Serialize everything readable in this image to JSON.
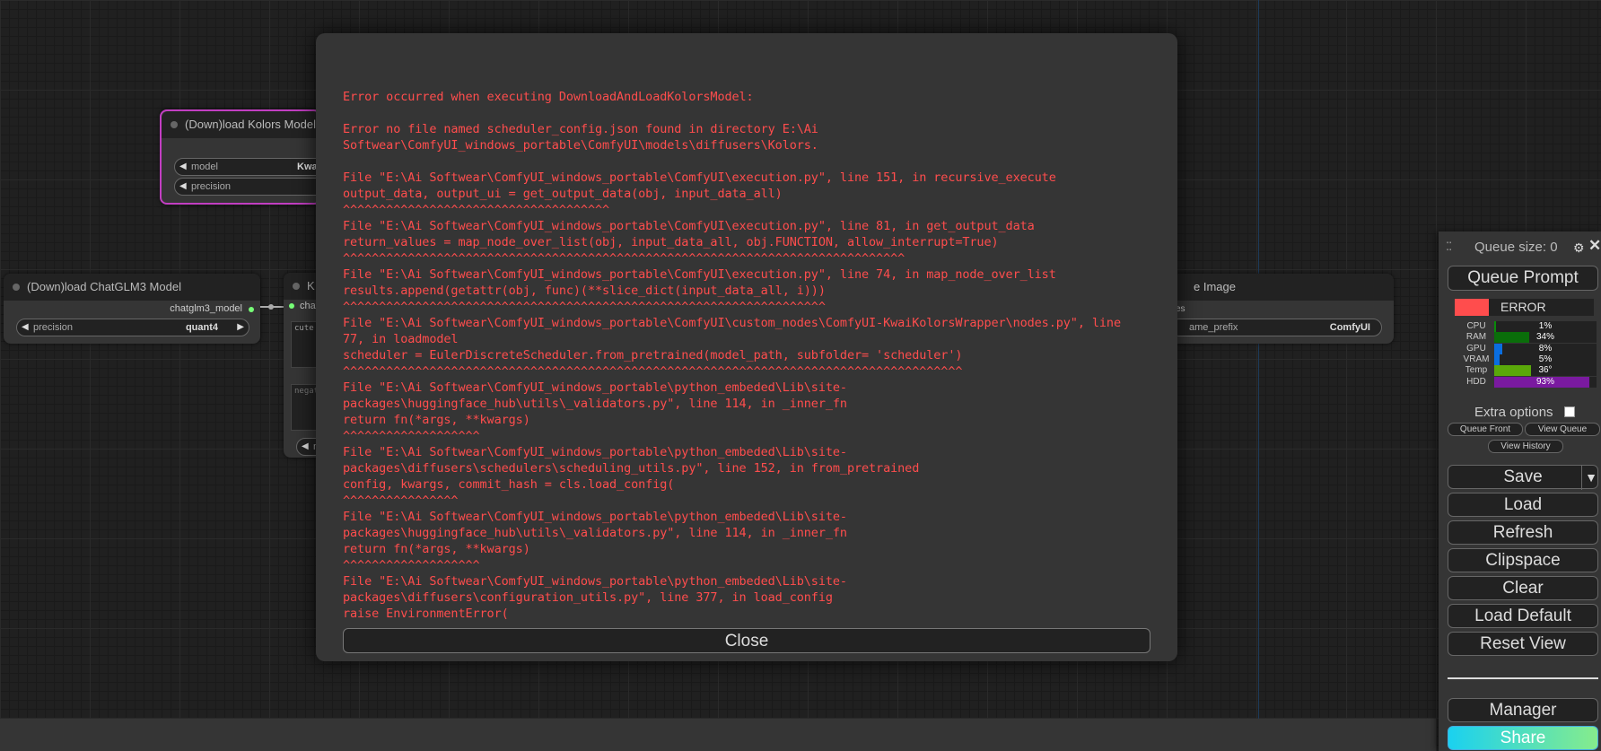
{
  "nodes": {
    "kolors": {
      "title": "(Down)load Kolors Model",
      "model_label": "model",
      "model_value": "Kwai",
      "precision_label": "precision"
    },
    "chatglm": {
      "title": "(Down)load ChatGLM3 Model",
      "output_label": "chatglm3_model",
      "precision_label": "precision",
      "precision_value": "quant4"
    },
    "encode": {
      "title": "K",
      "input_label": "chat",
      "positive_text": "cute",
      "negative_text": "negat",
      "widget_stub": "n"
    },
    "save_image": {
      "title": "e Image",
      "input_label": "es",
      "filename_label": "ame_prefix",
      "filename_value": "ComfyUI"
    }
  },
  "error_dialog": {
    "lines": [
      "",
      "Error occurred when executing DownloadAndLoadKolorsModel:",
      "",
      "Error no file named scheduler_config.json found in directory E:\\Ai",
      "Softwear\\ComfyUI_windows_portable\\ComfyUI\\models\\diffusers\\Kolors.",
      "",
      "File \"E:\\Ai Softwear\\ComfyUI_windows_portable\\ComfyUI\\execution.py\", line 151, in recursive_execute",
      "output_data, output_ui = get_output_data(obj, input_data_all)",
      "^^^^^^^^^^^^^^^^^^^^^^^^^^^^^^^^^^^^^",
      "File \"E:\\Ai Softwear\\ComfyUI_windows_portable\\ComfyUI\\execution.py\", line 81, in get_output_data",
      "return_values = map_node_over_list(obj, input_data_all, obj.FUNCTION, allow_interrupt=True)",
      "^^^^^^^^^^^^^^^^^^^^^^^^^^^^^^^^^^^^^^^^^^^^^^^^^^^^^^^^^^^^^^^^^^^^^^^^^^^^^^",
      "File \"E:\\Ai Softwear\\ComfyUI_windows_portable\\ComfyUI\\execution.py\", line 74, in map_node_over_list",
      "results.append(getattr(obj, func)(**slice_dict(input_data_all, i)))",
      "^^^^^^^^^^^^^^^^^^^^^^^^^^^^^^^^^^^^^^^^^^^^^^^^^^^^^^^^^^^^^^^^^^^",
      "File \"E:\\Ai Softwear\\ComfyUI_windows_portable\\ComfyUI\\custom_nodes\\ComfyUI-KwaiKolorsWrapper\\nodes.py\", line",
      "77, in loadmodel",
      "scheduler = EulerDiscreteScheduler.from_pretrained(model_path, subfolder= 'scheduler')",
      "^^^^^^^^^^^^^^^^^^^^^^^^^^^^^^^^^^^^^^^^^^^^^^^^^^^^^^^^^^^^^^^^^^^^^^^^^^^^^^^^^^^^^^",
      "File \"E:\\Ai Softwear\\ComfyUI_windows_portable\\python_embeded\\Lib\\site-",
      "packages\\huggingface_hub\\utils\\_validators.py\", line 114, in _inner_fn",
      "return fn(*args, **kwargs)",
      "^^^^^^^^^^^^^^^^^^^",
      "File \"E:\\Ai Softwear\\ComfyUI_windows_portable\\python_embeded\\Lib\\site-",
      "packages\\diffusers\\schedulers\\scheduling_utils.py\", line 152, in from_pretrained",
      "config, kwargs, commit_hash = cls.load_config(",
      "^^^^^^^^^^^^^^^^",
      "File \"E:\\Ai Softwear\\ComfyUI_windows_portable\\python_embeded\\Lib\\site-",
      "packages\\huggingface_hub\\utils\\_validators.py\", line 114, in _inner_fn",
      "return fn(*args, **kwargs)",
      "^^^^^^^^^^^^^^^^^^^",
      "File \"E:\\Ai Softwear\\ComfyUI_windows_portable\\python_embeded\\Lib\\site-",
      "packages\\diffusers\\configuration_utils.py\", line 377, in load_config",
      "raise EnvironmentError("
    ],
    "close_label": "Close",
    "error_color": "#ff4d4d"
  },
  "menu": {
    "queue_size": "Queue size: 0",
    "queue_prompt": "Queue Prompt",
    "status": "ERROR",
    "status_color": "#ff4d4d",
    "resources": [
      {
        "label": "CPU",
        "value": "1%",
        "percent": 1,
        "color": "#0a8a0a"
      },
      {
        "label": "RAM",
        "value": "34%",
        "percent": 34,
        "color": "#0a6e0a"
      },
      {
        "label": "GPU",
        "value": "8%",
        "percent": 8,
        "color": "#0a6ee0"
      },
      {
        "label": "VRAM",
        "value": "5%",
        "percent": 5,
        "color": "#0a6ee0"
      },
      {
        "label": "Temp",
        "value": "36°",
        "percent": 36,
        "color": "#5aa80a"
      },
      {
        "label": "HDD",
        "value": "93%",
        "percent": 93,
        "color": "#7a1aa0"
      }
    ],
    "extra_options": "Extra options",
    "queue_front": "Queue Front",
    "view_queue": "View Queue",
    "view_history": "View History",
    "save": "Save",
    "load": "Load",
    "refresh": "Refresh",
    "clipspace": "Clipspace",
    "clear": "Clear",
    "load_default": "Load Default",
    "reset_view": "Reset View",
    "manager": "Manager",
    "share": "Share"
  }
}
